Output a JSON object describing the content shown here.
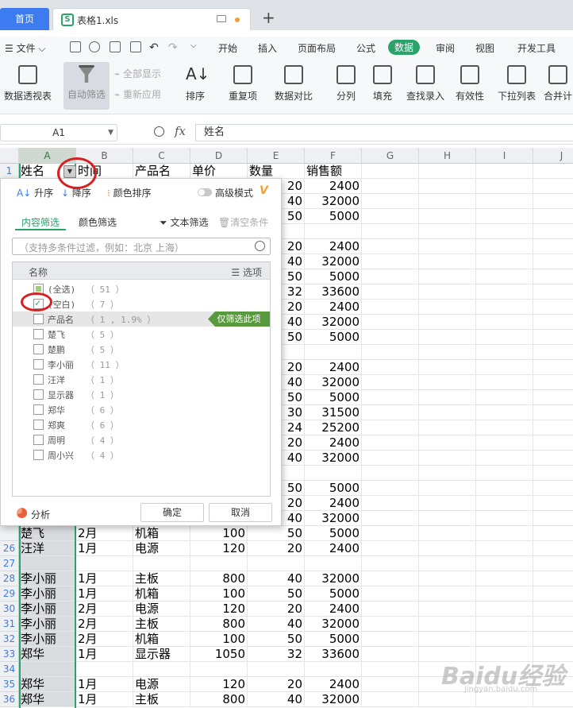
{
  "tabs": {
    "home": "首页",
    "file": "表格1.xls"
  },
  "menu": {
    "file": "文件",
    "items": [
      "开始",
      "插入",
      "页面布局",
      "公式",
      "数据",
      "审阅",
      "视图",
      "开发工具"
    ],
    "active": "数据"
  },
  "ribbon": {
    "pivot": "数据透视表",
    "autofilter": "自动筛选",
    "show_all": "全部显示",
    "reapply": "重新应用",
    "sort": "排序",
    "duplicates": "重复项",
    "compare": "数据对比",
    "split": "分列",
    "fill": "填充",
    "lookup": "查找录入",
    "validity": "有效性",
    "dropdown": "下拉列表",
    "merge": "合并计"
  },
  "formula_bar": {
    "cell_ref": "A1",
    "fx": "fx",
    "value": "姓名"
  },
  "columns": [
    "A",
    "B",
    "C",
    "D",
    "E",
    "F",
    "G",
    "H",
    "I",
    "J"
  ],
  "rows_top": [
    {
      "n": "1",
      "a": "姓名",
      "b": "时间",
      "c": "产品名",
      "d": "单价",
      "e": "数量",
      "f": "销售额"
    }
  ],
  "partial_values": [
    [
      "20",
      "2400"
    ],
    [
      "40",
      "32000"
    ],
    [
      "50",
      "5000"
    ],
    [
      "",
      ""
    ],
    [
      "20",
      "2400"
    ],
    [
      "40",
      "32000"
    ],
    [
      "50",
      "5000"
    ],
    [
      "32",
      "33600"
    ],
    [
      "20",
      "2400"
    ],
    [
      "40",
      "32000"
    ],
    [
      "50",
      "5000"
    ],
    [
      "",
      ""
    ],
    [
      "20",
      "2400"
    ],
    [
      "40",
      "32000"
    ],
    [
      "50",
      "5000"
    ],
    [
      "30",
      "31500"
    ],
    [
      "24",
      "25200"
    ],
    [
      "20",
      "2400"
    ],
    [
      "40",
      "32000"
    ],
    [
      "",
      ""
    ],
    [
      "50",
      "5000"
    ],
    [
      "20",
      "2400"
    ],
    [
      "40",
      "32000"
    ]
  ],
  "rows_bottom": [
    {
      "n": "",
      "a": "楚飞",
      "b": "2月",
      "c": "机箱",
      "d": "100",
      "e": "50",
      "f": "5000"
    },
    {
      "n": "26",
      "a": "汪洋",
      "b": "1月",
      "c": "电源",
      "d": "120",
      "e": "20",
      "f": "2400"
    },
    {
      "n": "27",
      "a": "",
      "b": "",
      "c": "",
      "d": "",
      "e": "",
      "f": ""
    },
    {
      "n": "28",
      "a": "李小丽",
      "b": "1月",
      "c": "主板",
      "d": "800",
      "e": "40",
      "f": "32000"
    },
    {
      "n": "29",
      "a": "李小丽",
      "b": "1月",
      "c": "机箱",
      "d": "100",
      "e": "50",
      "f": "5000"
    },
    {
      "n": "30",
      "a": "李小丽",
      "b": "2月",
      "c": "电源",
      "d": "120",
      "e": "20",
      "f": "2400"
    },
    {
      "n": "31",
      "a": "李小丽",
      "b": "2月",
      "c": "主板",
      "d": "800",
      "e": "40",
      "f": "32000"
    },
    {
      "n": "32",
      "a": "李小丽",
      "b": "2月",
      "c": "机箱",
      "d": "100",
      "e": "50",
      "f": "5000"
    },
    {
      "n": "33",
      "a": "郑华",
      "b": "1月",
      "c": "显示器",
      "d": "1050",
      "e": "32",
      "f": "33600"
    },
    {
      "n": "34",
      "a": "",
      "b": "",
      "c": "",
      "d": "",
      "e": "",
      "f": ""
    },
    {
      "n": "35",
      "a": "郑华",
      "b": "1月",
      "c": "电源",
      "d": "120",
      "e": "20",
      "f": "2400"
    },
    {
      "n": "36",
      "a": "郑华",
      "b": "1月",
      "c": "主板",
      "d": "800",
      "e": "40",
      "f": "32000"
    }
  ],
  "filter_panel": {
    "sort_asc": "升序",
    "sort_desc": "降序",
    "color_sort": "颜色排序",
    "advanced": "高级模式",
    "vip": "V",
    "tab_content": "内容筛选",
    "tab_color": "颜色筛选",
    "text_filter": "文本筛选",
    "clear": "清空条件",
    "search_placeholder": "（支持多条件过滤，例如：北京 上海）",
    "list_header": "名称",
    "options": "选项",
    "items": [
      {
        "label": "(全选)",
        "count": "（ 51 ）",
        "state": "part"
      },
      {
        "label": "(空白)",
        "count": "（ 7 ）",
        "state": "chk"
      },
      {
        "label": "产品名",
        "count": "（ 1 , 1.9% ）",
        "state": "none"
      },
      {
        "label": "楚飞",
        "count": "（ 5 ）",
        "state": "none"
      },
      {
        "label": "楚鹏",
        "count": "（ 5 ）",
        "state": "none"
      },
      {
        "label": "李小丽",
        "count": "（ 11 ）",
        "state": "none"
      },
      {
        "label": "汪洋",
        "count": "（ 1 ）",
        "state": "none"
      },
      {
        "label": "显示器",
        "count": "（ 1 ）",
        "state": "none"
      },
      {
        "label": "郑华",
        "count": "（ 6 ）",
        "state": "none"
      },
      {
        "label": "郑爽",
        "count": "（ 6 ）",
        "state": "none"
      },
      {
        "label": "周明",
        "count": "（ 4 ）",
        "state": "none"
      },
      {
        "label": "周小兴",
        "count": "（ 4 ）",
        "state": "none"
      }
    ],
    "only_this": "仅筛选此项",
    "analysis": "分析",
    "ok": "确定",
    "cancel": "取消"
  },
  "watermark": {
    "main": "Baidu经验",
    "sub": "jingyan.baidu.com"
  }
}
